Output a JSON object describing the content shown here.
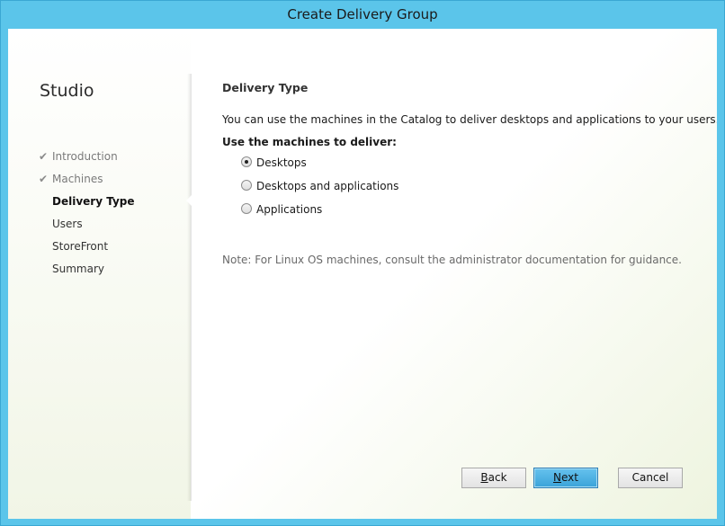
{
  "window": {
    "title": "Create Delivery Group"
  },
  "sidebar": {
    "title": "Studio",
    "steps": [
      {
        "label": "Introduction",
        "state": "done"
      },
      {
        "label": "Machines",
        "state": "done"
      },
      {
        "label": "Delivery Type",
        "state": "active"
      },
      {
        "label": "Users",
        "state": "pending"
      },
      {
        "label": "StoreFront",
        "state": "pending"
      },
      {
        "label": "Summary",
        "state": "pending"
      }
    ]
  },
  "main": {
    "section_title": "Delivery Type",
    "intro": "You can use the machines in the Catalog to deliver desktops and applications to your users.",
    "use_label": "Use the machines to deliver:",
    "options": [
      {
        "label": "Desktops",
        "selected": true
      },
      {
        "label": "Desktops and applications",
        "selected": false
      },
      {
        "label": "Applications",
        "selected": false
      }
    ],
    "note": "Note: For Linux OS machines, consult the administrator documentation for guidance."
  },
  "buttons": {
    "back": {
      "accel": "B",
      "rest": "ack"
    },
    "next": {
      "accel": "N",
      "rest": "ext"
    },
    "cancel": "Cancel"
  },
  "colors": {
    "titlebar": "#5bc5ea",
    "primary_button": "#3aa3d9"
  }
}
